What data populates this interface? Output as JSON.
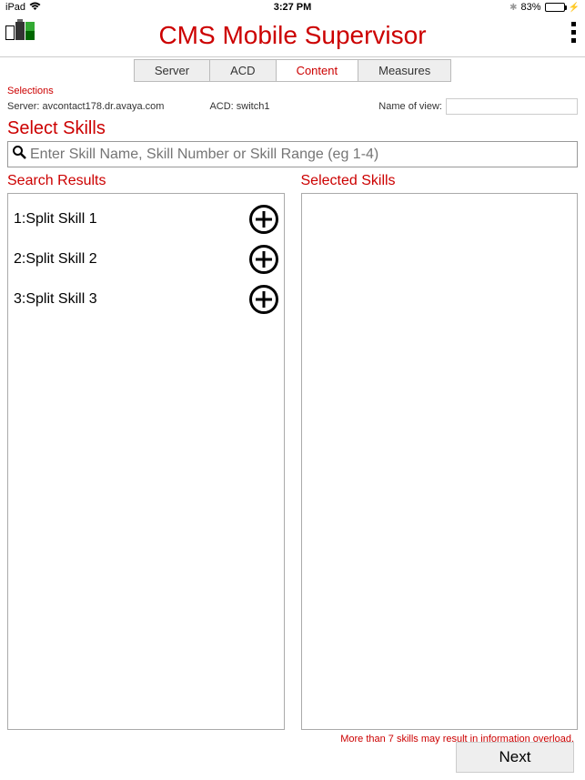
{
  "status": {
    "carrier": "iPad",
    "time": "3:27 PM",
    "battery_pct": "83%"
  },
  "header": {
    "title": "CMS Mobile Supervisor"
  },
  "tabs": {
    "server": "Server",
    "acd": "ACD",
    "content": "Content",
    "measures": "Measures"
  },
  "selections": {
    "label": "Selections",
    "server_label": "Server:",
    "server_value": "avcontact178.dr.avaya.com",
    "acd_label": "ACD:",
    "acd_value": "switch1",
    "name_label": "Name of view:",
    "name_value": ""
  },
  "section": {
    "title": "Select Skills"
  },
  "search": {
    "placeholder": "Enter Skill Name, Skill Number or Skill Range (eg 1-4)"
  },
  "results": {
    "title": "Search Results",
    "items": [
      {
        "label": "1:Split Skill 1"
      },
      {
        "label": "2:Split Skill 2"
      },
      {
        "label": "3:Split Skill 3"
      }
    ]
  },
  "selected": {
    "title": "Selected Skills"
  },
  "warning": "More than 7 skills may result in information overload.",
  "next_label": "Next"
}
